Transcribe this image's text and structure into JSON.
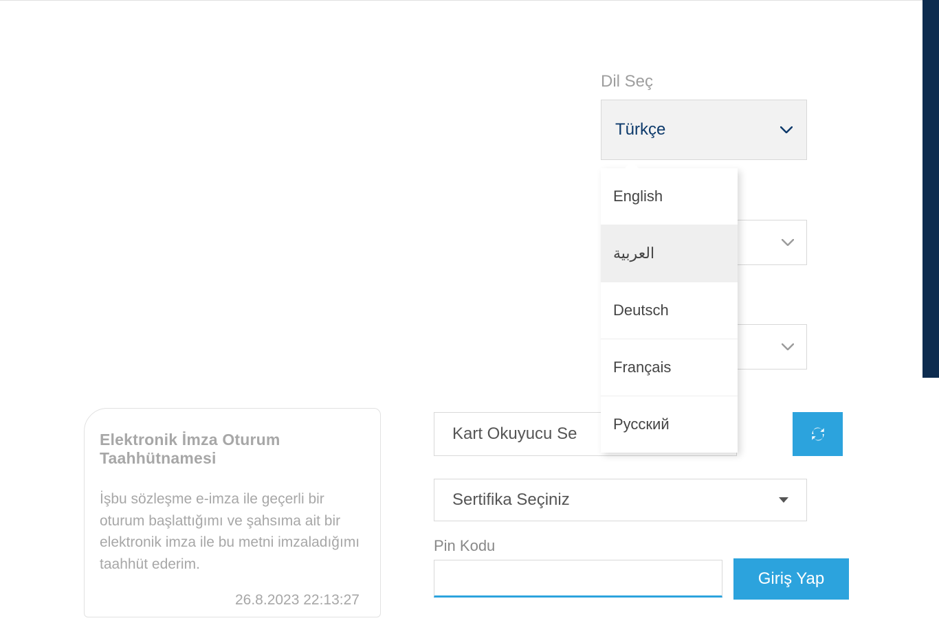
{
  "language": {
    "label": "Dil Seç",
    "selected": "Türkçe",
    "options": [
      "English",
      "العربية",
      "Deutsch",
      "Français",
      "Русский"
    ],
    "hovered_index": 1
  },
  "card_reader": {
    "placeholder": "Kart Okuyucu Se"
  },
  "certificate": {
    "placeholder": "Sertifika Seçiniz"
  },
  "pin": {
    "label": "Pin Kodu",
    "value": ""
  },
  "login_button": "Giriş Yap",
  "agreement": {
    "title": "Elektronik İmza Oturum Taahhütnamesi",
    "body": "İşbu sözleşme e-imza ile geçerli bir oturum başlattığımı ve şahsıma ait bir elektronik imza ile bu metni imzaladığımı taahhüt ederim.",
    "timestamp": "26.8.2023 22:13:27"
  },
  "colors": {
    "primary": "#2ca3dd",
    "dark_navy": "#0d2c4f",
    "select_text": "#0d3a6b"
  }
}
